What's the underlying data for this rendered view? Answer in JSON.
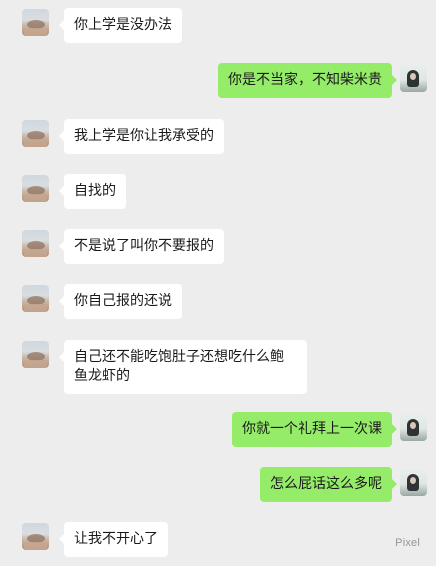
{
  "messages": [
    {
      "side": "left",
      "text": "你上学是没办法"
    },
    {
      "side": "right",
      "text": "你是不当家，不知柴米贵"
    },
    {
      "side": "left",
      "text": "我上学是你让我承受的"
    },
    {
      "side": "left",
      "text": "自找的"
    },
    {
      "side": "left",
      "text": "不是说了叫你不要报的"
    },
    {
      "side": "left",
      "text": "你自己报的还说"
    },
    {
      "side": "left",
      "text": "自己还不能吃饱肚子还想吃什么鲍鱼龙虾的"
    },
    {
      "side": "right",
      "text": "你就一个礼拜上一次课"
    },
    {
      "side": "right",
      "text": "怎么屁话这么多呢"
    },
    {
      "side": "left",
      "text": "让我不开心了"
    }
  ],
  "watermark": "Pixel"
}
